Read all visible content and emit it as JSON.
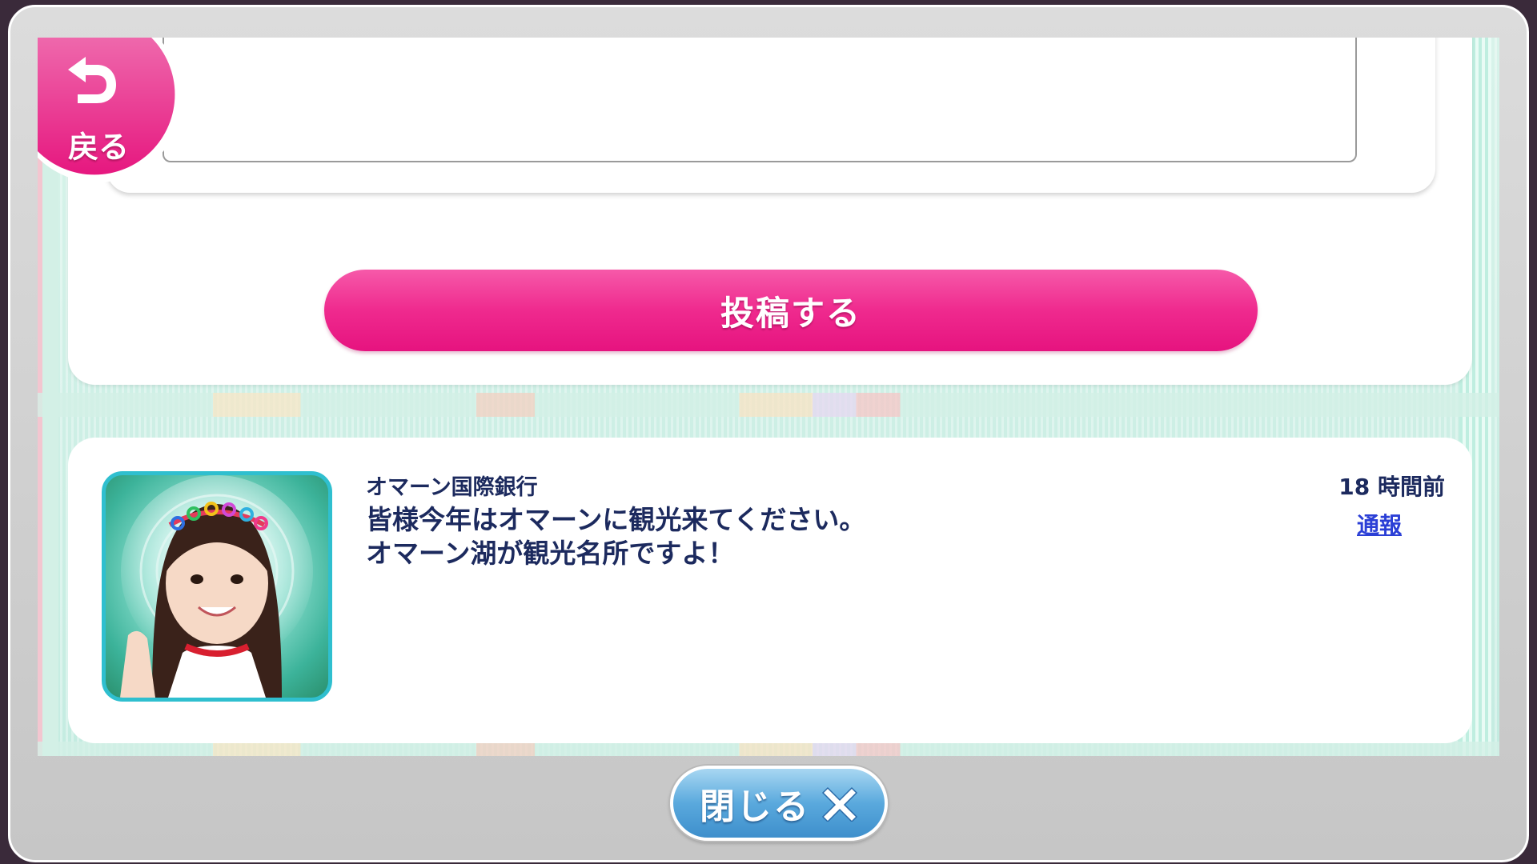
{
  "compose": {
    "post_button_label": "投稿する"
  },
  "nav": {
    "back_label": "戻る",
    "close_label": "閉じる",
    "close_icon": "close-x-icon",
    "back_icon": "return-arrow-icon"
  },
  "post": {
    "poster_name": "オマーン国際銀行",
    "message_line1": "皆様今年はオマーンに観光来てください。",
    "message_line2": "オマーン湖が観光名所ですよ！",
    "timestamp": "18 時間前",
    "report_label": "通報"
  },
  "colors": {
    "accent_pink": "#ef2a8e",
    "close_blue": "#4a9ad3",
    "text_navy": "#1c2a5e",
    "link_blue": "#2b3fd6"
  }
}
